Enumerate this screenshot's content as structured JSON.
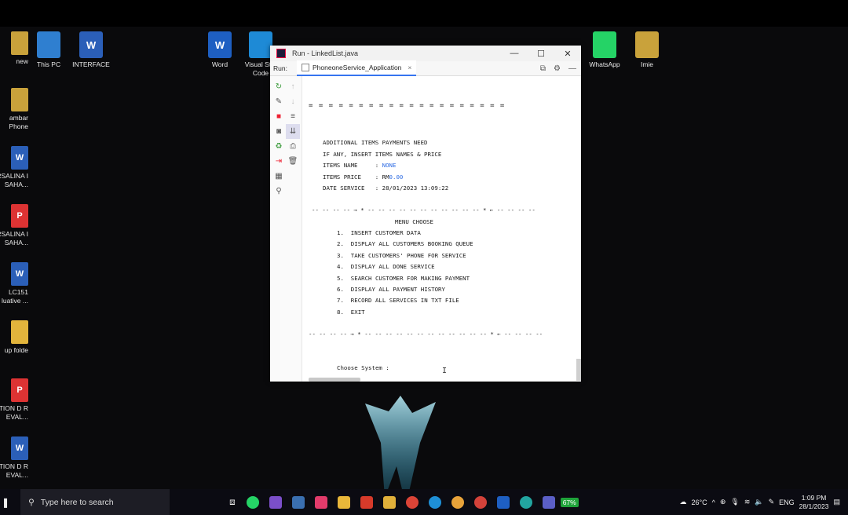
{
  "desktop": {
    "icons": [
      {
        "label": "This PC",
        "color": "#2f7fd0"
      },
      {
        "label": "INTERFACE",
        "color": "#2b5fb8",
        "glyph": "W"
      },
      {
        "label": "Word",
        "color": "#1e5fc2",
        "glyph": "W"
      },
      {
        "label": "Visual St... Code",
        "color": "#1e8ad6"
      },
      {
        "label": "WhatsApp",
        "color": "#25d366"
      },
      {
        "label": "Imie",
        "color": "#c9a23b"
      }
    ],
    "left_icons": [
      {
        "label": "new",
        "color": "#c9a23b"
      },
      {
        "label": "ambar Phone",
        "color": "#c9a23b"
      },
      {
        "label": "RSALINA I SAHA...",
        "color": "#2b5fb8",
        "glyph": "W"
      },
      {
        "label": "RSALINA I SAHA...",
        "color": "#d33",
        "glyph": "P"
      },
      {
        "label": "LC151 luative ...",
        "color": "#2b5fb8",
        "glyph": "W"
      },
      {
        "label": "up folde",
        "color": "#e2b43c"
      },
      {
        "label": "TION D R EVAL...",
        "color": "#d33",
        "glyph": "P"
      },
      {
        "label": "TION D R EVAL...",
        "color": "#2b5fb8",
        "glyph": "W"
      }
    ]
  },
  "window": {
    "title": "Run - LinkedList.java",
    "controls": {
      "minimize": "—",
      "maximize": "☐",
      "close": "✕"
    },
    "run_label": "Run:",
    "tab_label": "PhoneoneService_Application",
    "tab_close": "×"
  },
  "console": {
    "separator_top": "= = = = = = = = = = = = = = = = = = = =",
    "additional_heading": "ADDITIONAL ITEMS PAYMENTS NEED",
    "insert_prompt": "IF ANY, INSERT ITEMS NAMES & PRICE",
    "items_name_label": "ITEMS NAME     : ",
    "items_name_value": "NONE",
    "items_price_label": "ITEMS PRICE    : RM",
    "items_price_value": "0.00",
    "date_service": "DATE SERVICE   : 28/01/2023 13:09:22",
    "divider_1": "-- -- -- -- → * -- -- -- -- -- -- -- -- -- -- -- * ← -- -- -- --",
    "menu_title": "MENU CHOOSE",
    "menu_items": [
      "1.  INSERT CUSTOMER DATA",
      "2.  DISPLAY ALL CUSTOMERS BOOKING QUEUE",
      "3.  TAKE CUSTOMERS' PHONE FOR SERVICE",
      "4.  DISPLAY ALL DONE SERVICE",
      "5.  SEARCH CUSTOMER FOR MAKING PAYMENT",
      "6.  DISPLAY ALL PAYMENT HISTORY",
      "7.  RECORD ALL SERVICES IN TXT FILE",
      "8.  EXIT"
    ],
    "divider_2": "-- -- -- -- → * -- -- -- -- -- -- -- -- -- -- -- -- * ← -- -- -- --",
    "choose_prompt": "Choose System :"
  },
  "taskbar": {
    "search_placeholder": "Type here to search",
    "battery": "67%",
    "weather": "26°C",
    "language": "ENG",
    "time": "1:09 PM",
    "date": "28/1/2023"
  }
}
